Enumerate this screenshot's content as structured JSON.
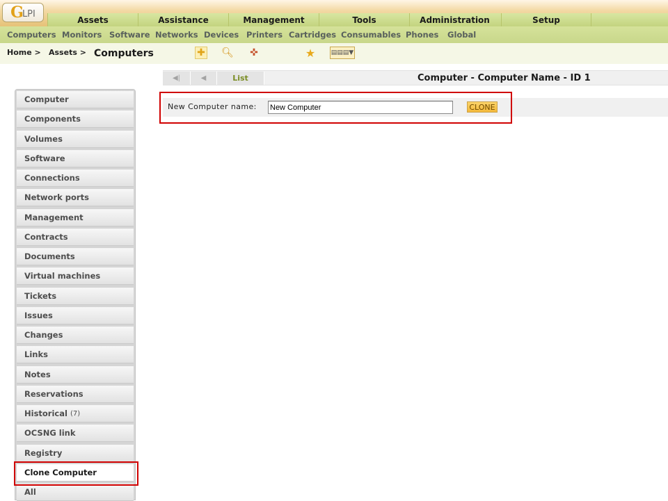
{
  "logo": {
    "initial": "G",
    "text": "LPI"
  },
  "main_menu": [
    "Assets",
    "Assistance",
    "Management",
    "Tools",
    "Administration",
    "Setup"
  ],
  "sub_menu": [
    "Computers",
    "Monitors",
    "Software",
    "Networks",
    "Devices",
    "Printers",
    "Cartridges",
    "Consumables",
    "Phones",
    "Global"
  ],
  "breadcrumb": {
    "home": "Home >",
    "assets": "Assets >",
    "current": "Computers"
  },
  "toolbar_icons": [
    "add-icon",
    "search-icon",
    "template-icon",
    "star-icon",
    "list-view-icon"
  ],
  "navigation": {
    "list_label": "List",
    "item_title": "Computer - Computer Name - ID 1"
  },
  "clone_form": {
    "label": "New Computer name:",
    "value": "New Computer",
    "button": "CLONE"
  },
  "tabs": [
    {
      "label": "Computer"
    },
    {
      "label": "Components"
    },
    {
      "label": "Volumes"
    },
    {
      "label": "Software"
    },
    {
      "label": "Connections"
    },
    {
      "label": "Network ports"
    },
    {
      "label": "Management"
    },
    {
      "label": "Contracts"
    },
    {
      "label": "Documents"
    },
    {
      "label": "Virtual machines"
    },
    {
      "label": "Tickets"
    },
    {
      "label": "Issues"
    },
    {
      "label": "Changes"
    },
    {
      "label": "Links"
    },
    {
      "label": "Notes"
    },
    {
      "label": "Reservations"
    },
    {
      "label": "Historical",
      "count": "(7)"
    },
    {
      "label": "OCSNG link"
    },
    {
      "label": "Registry"
    },
    {
      "label": "Clone Computer",
      "active": true
    },
    {
      "label": "All"
    }
  ],
  "colors": {
    "accent_green": "#c8d78a",
    "highlight_red": "#d00000",
    "button_orange": "#f4b93a"
  }
}
